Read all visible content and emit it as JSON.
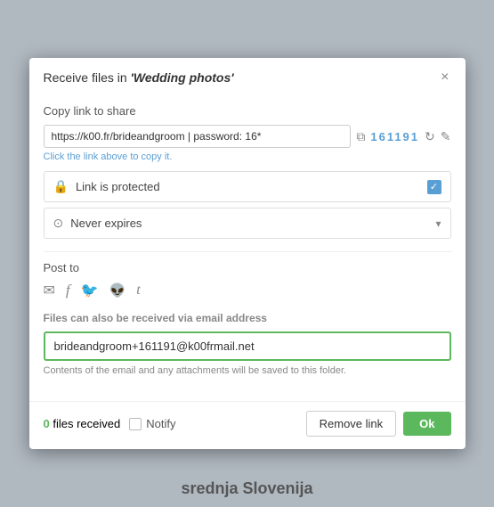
{
  "modal": {
    "title_prefix": "Receive files in ",
    "title_folder": "'Wedding photos'",
    "close_label": "×",
    "copy_link_section": "Copy link to share",
    "link_url": "https://k00.fr/brideandgroom | password: 16*",
    "link_code": "161191",
    "click_hint": "Click the link above to copy it.",
    "link_protected_label": "Link is protected",
    "never_expires_label": "Never expires",
    "post_to_label": "Post to",
    "email_section_title": "Files can also be received via email address",
    "email_address": "brideandgroom+161191@k00frmail.net",
    "email_hint": "Contents of the email and any attachments will be saved to this folder.",
    "files_received_count": "0",
    "files_received_label": "files received",
    "notify_label": "Notify",
    "remove_link_label": "Remove link",
    "ok_label": "Ok"
  },
  "icons": {
    "close": "×",
    "external_link": "⧉",
    "edit": "✎",
    "refresh": "↻",
    "lock": "🔒",
    "clock": "⊙",
    "check": "✓",
    "chevron_down": "▾",
    "email": "✉",
    "facebook": "f",
    "twitter": "t",
    "reddit": "r",
    "tumblr": "t"
  }
}
